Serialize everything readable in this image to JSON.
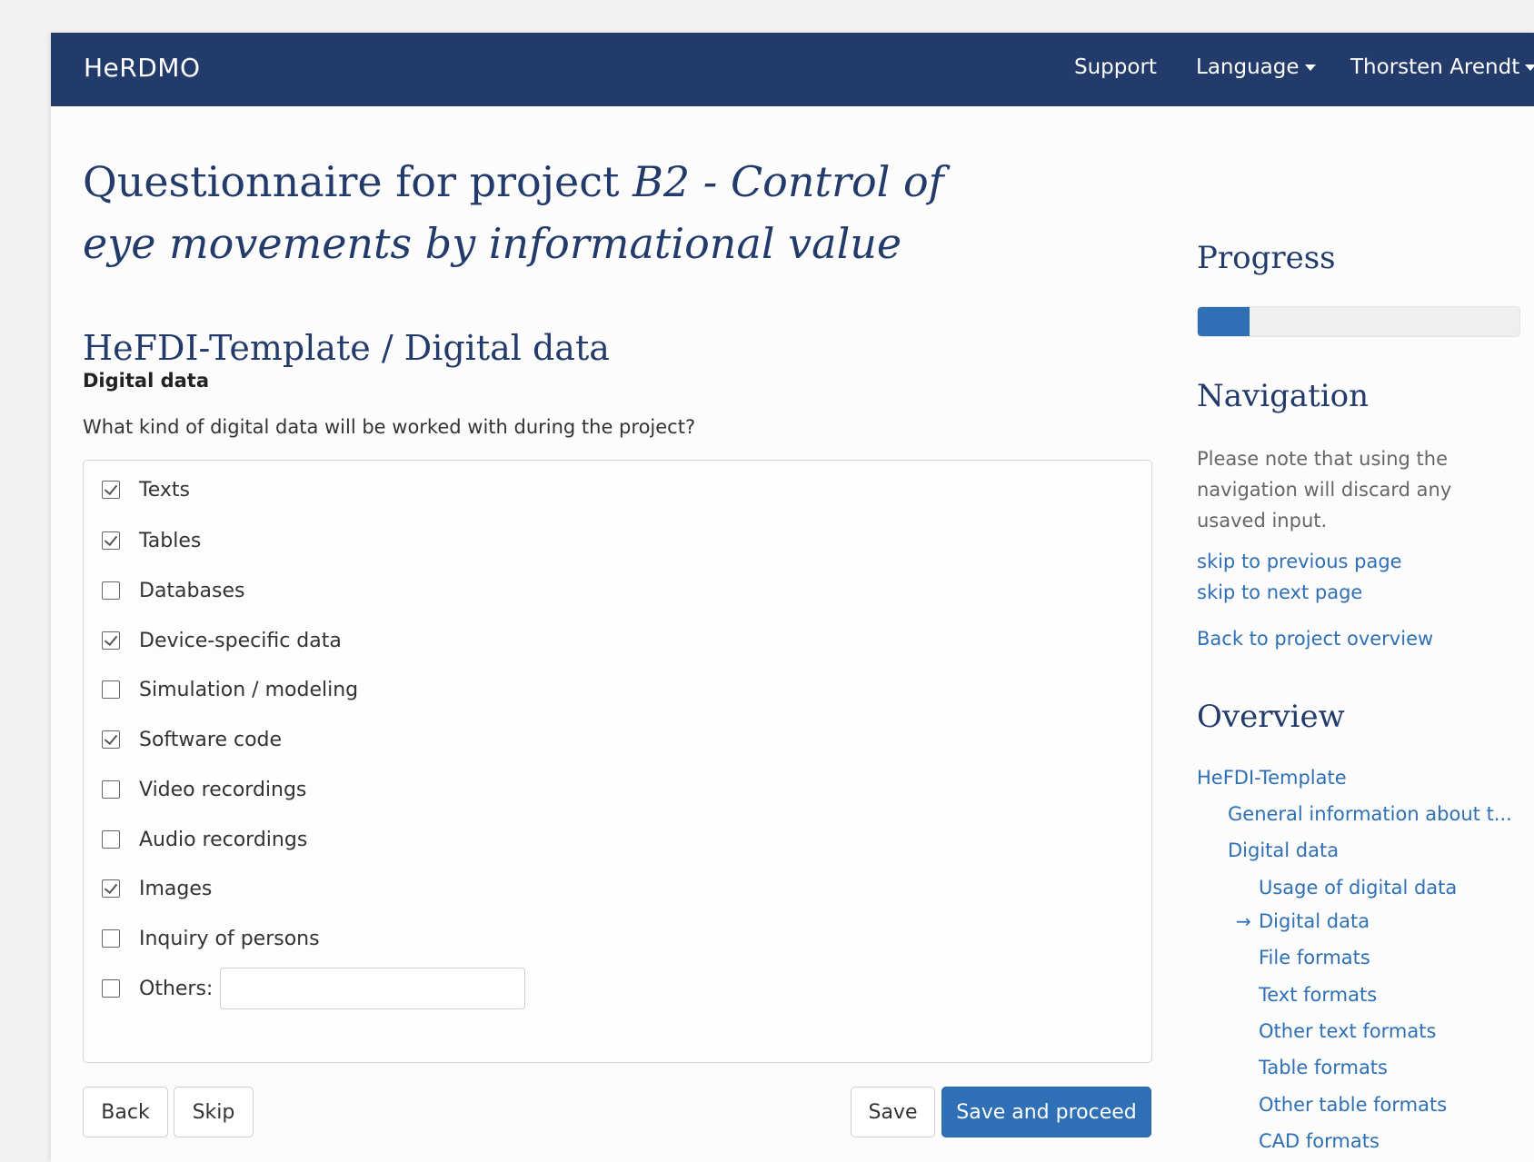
{
  "header": {
    "brand": "HeRDMO",
    "support": "Support",
    "language": "Language",
    "user": "Thorsten Arendt"
  },
  "title": {
    "prefix": "Questionnaire for project ",
    "project": "B2 - Control of eye movements by informational value"
  },
  "section": "HeFDI-Template / Digital data",
  "question": {
    "label": "Digital data",
    "text": "What kind of digital data will be worked with during the project?"
  },
  "options": [
    {
      "label": "Texts",
      "checked": true
    },
    {
      "label": "Tables",
      "checked": true
    },
    {
      "label": "Databases",
      "checked": false
    },
    {
      "label": "Device-specific data",
      "checked": true
    },
    {
      "label": "Simulation / modeling",
      "checked": false
    },
    {
      "label": "Software code",
      "checked": true
    },
    {
      "label": "Video recordings",
      "checked": false
    },
    {
      "label": "Audio recordings",
      "checked": false
    },
    {
      "label": "Images",
      "checked": true
    },
    {
      "label": "Inquiry of persons",
      "checked": false
    },
    {
      "label": "Others:",
      "checked": false,
      "input_value": ""
    }
  ],
  "buttons": {
    "back": "Back",
    "skip": "Skip",
    "save": "Save",
    "save_proceed": "Save and proceed"
  },
  "sidebar": {
    "progress_heading": "Progress",
    "progress_value": 0.16,
    "navigation_heading": "Navigation",
    "navigation_note": "Please note that using the navigation will discard any usaved input.",
    "skip_previous": "skip to previous page",
    "skip_next": "skip to next page",
    "back_overview": "Back to project overview",
    "overview_heading": "Overview",
    "overview": {
      "root": "HeFDI-Template",
      "general": "General information about t...",
      "digital_data": "Digital data",
      "current_marker": "→",
      "pages": [
        "Usage of digital data",
        "Digital data",
        "File formats",
        "Text formats",
        "Other text formats",
        "Table formats",
        "Other table formats",
        "CAD formats"
      ]
    }
  },
  "colors": {
    "navbar": "#233b6b",
    "primary": "#2f6fb5",
    "heading": "#233b6b"
  }
}
